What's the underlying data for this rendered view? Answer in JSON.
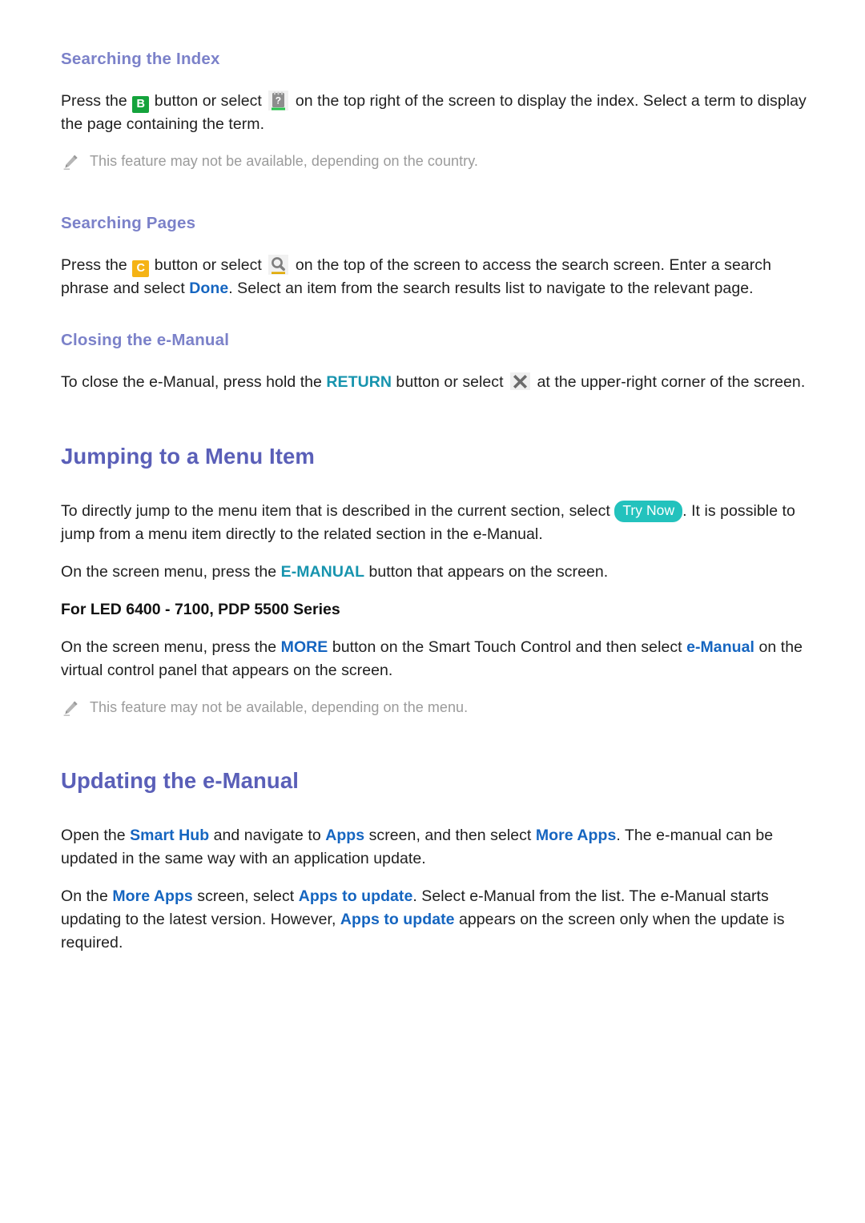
{
  "document": {
    "colors": {
      "section_heading": "#5a5fb8",
      "sub_heading": "#7b81c9",
      "body_text": "#1f1f1f",
      "link_blue": "#1565c0",
      "link_teal": "#1794ae",
      "note_text": "#9b9b9b",
      "key_b_background": "#14a33c",
      "key_c_background": "#f5b315",
      "try_now_background": "#23c2bd",
      "page_background": "#ffffff"
    },
    "sections": {
      "searching_index": {
        "heading": "Searching the Index",
        "paragraph": {
          "part1": "Press the ",
          "key_b_label": "B",
          "part2": " button or select ",
          "icon_index_name": "index-icon",
          "part3": " on the top right of the screen to display the index. Select a term to display the page containing the term."
        },
        "note": "This feature may not be available, depending on the country."
      },
      "searching_pages": {
        "heading": "Searching Pages",
        "paragraph": {
          "part1": "Press the ",
          "key_c_label": "C",
          "part2": " button or select ",
          "icon_search_name": "search-icon",
          "part3": " on the top of the screen to access the search screen. Enter a search phrase and select ",
          "link_done": "Done",
          "part4": ". Select an item from the search results list to navigate to the relevant page."
        }
      },
      "closing_emanual": {
        "heading": "Closing the e-Manual",
        "paragraph": {
          "part1": "To close the e-Manual, press hold the ",
          "link_return": "RETURN",
          "part2": " button or select ",
          "icon_close_name": "close-icon",
          "part3": " at the upper-right corner of the screen."
        }
      },
      "jumping_menu_item": {
        "heading": "Jumping to a Menu Item",
        "paragraph1": {
          "part1": "To directly jump to the menu item that is described in the current section, select ",
          "badge_try_now": "Try Now",
          "part2": ". It is possible to jump from a menu item directly to the related section in the e-Manual."
        },
        "paragraph2": {
          "part1": "On the screen menu, press the ",
          "link_emanual": "E-MANUAL",
          "part2": " button that appears on the screen."
        },
        "series_line": "For LED 6400 - 7100, PDP 5500 Series",
        "paragraph3": {
          "part1": "On the screen menu, press the ",
          "link_more": "MORE",
          "part2": " button on the Smart Touch Control and then select ",
          "link_emanual": "e-Manual",
          "part3": " on the virtual control panel that appears on the screen."
        },
        "note": "This feature may not be available, depending on the menu."
      },
      "updating_emanual": {
        "heading": "Updating the e-Manual",
        "paragraph1": {
          "part1": "Open the ",
          "link_smart_hub": "Smart Hub",
          "part2": " and navigate to ",
          "link_apps": "Apps",
          "part3": " screen, and then select ",
          "link_more_apps": "More Apps",
          "part4": ". The e-manual can be updated in the same way with an application update."
        },
        "paragraph2": {
          "part1": "On the ",
          "link_more_apps": "More Apps",
          "part2": " screen, select ",
          "link_apps_to_update": "Apps to update",
          "part3": ". Select e-Manual from the list. The e-Manual starts updating to the latest version. However, ",
          "link_apps_to_update_2": "Apps to update",
          "part4": " appears on the screen only when the update is required."
        }
      }
    }
  }
}
